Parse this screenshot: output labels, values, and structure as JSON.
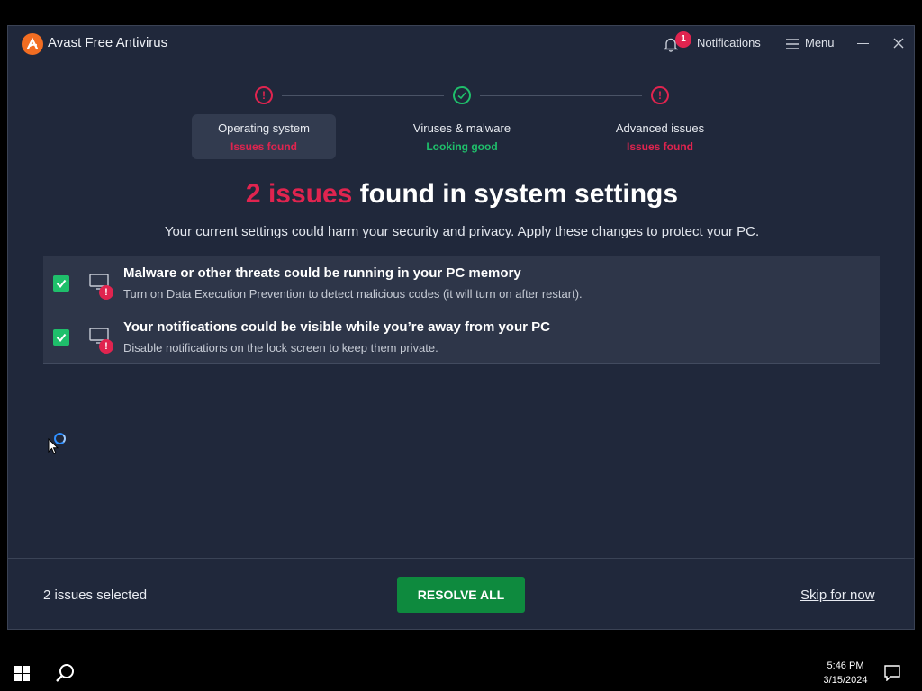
{
  "app": {
    "title": "Avast Free Antivirus",
    "notifications_label": "Notifications",
    "notifications_count": "1",
    "menu_label": "Menu"
  },
  "steps": [
    {
      "title": "Operating system",
      "status": "Issues found",
      "state": "error",
      "active": true
    },
    {
      "title": "Viruses & malware",
      "status": "Looking good",
      "state": "ok",
      "active": false
    },
    {
      "title": "Advanced issues",
      "status": "Issues found",
      "state": "error",
      "active": false
    }
  ],
  "heading": {
    "count": "2 issues",
    "rest": " found in system settings",
    "subtitle": "Your current settings could harm your security and privacy. Apply these changes to protect your PC."
  },
  "issues": [
    {
      "title": "Malware or other threats could be running in your PC memory",
      "description": "Turn on Data Execution Prevention to detect malicious codes (it will turn on after restart).",
      "checked": true
    },
    {
      "title": "Your notifications could be visible while you’re away from your PC",
      "description": "Disable notifications on the lock screen to keep them private.",
      "checked": true
    }
  ],
  "footer": {
    "selected_text": "2 issues selected",
    "resolve_label": "RESOLVE ALL",
    "skip_label": "Skip for now"
  },
  "taskbar": {
    "time": "5:46 PM",
    "date": "3/15/2024"
  },
  "colors": {
    "window_bg": "#20283b",
    "danger": "#e0244f",
    "success": "#1fbf6b",
    "resolve_button": "#0e8a3e",
    "brand_orange": "#f26d22"
  },
  "icons": [
    "avast-logo-icon",
    "bell-icon",
    "hamburger-icon",
    "minimize-icon",
    "close-icon",
    "alert-icon",
    "check-icon",
    "monitor-icon",
    "windows-start-icon",
    "search-icon",
    "action-center-icon"
  ]
}
